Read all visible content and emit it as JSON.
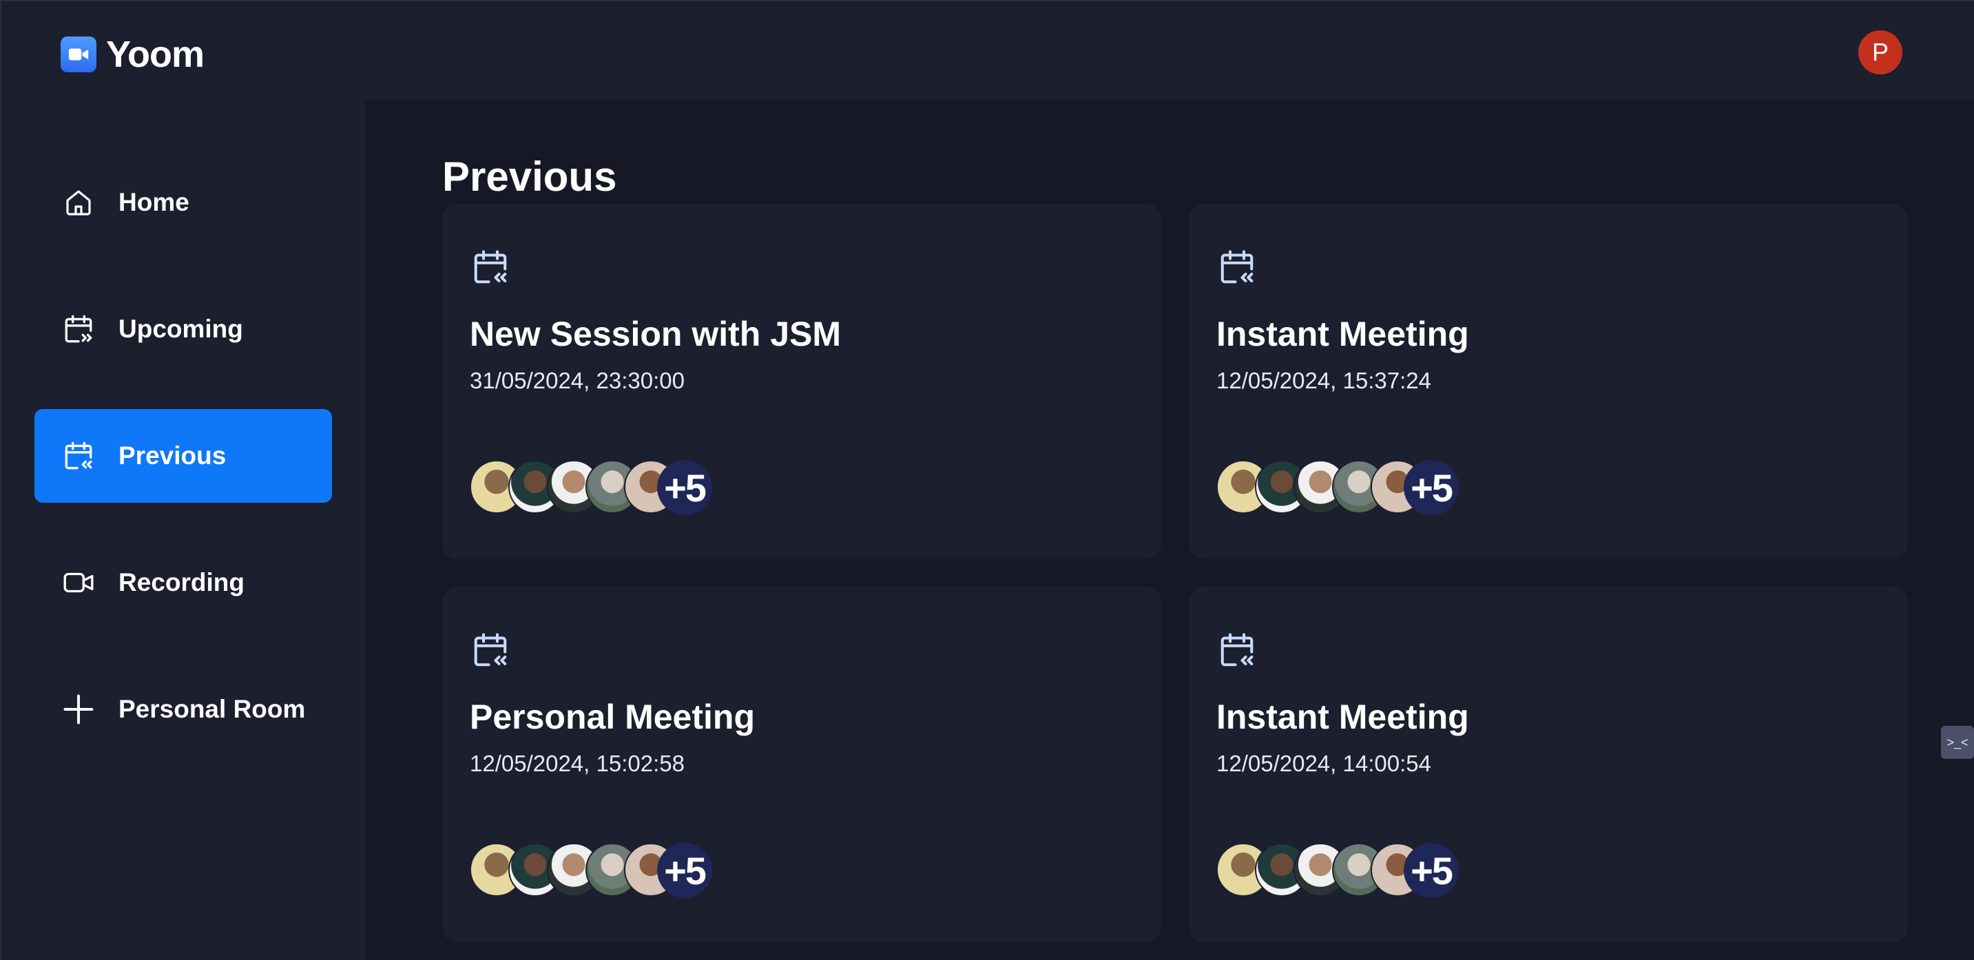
{
  "app": {
    "name": "Yoom",
    "user_initial": "P"
  },
  "sidebar": {
    "items": [
      {
        "label": "Home",
        "icon": "home-icon",
        "active": false
      },
      {
        "label": "Upcoming",
        "icon": "calendar-forward-icon",
        "active": false
      },
      {
        "label": "Previous",
        "icon": "calendar-back-icon",
        "active": true
      },
      {
        "label": "Recording",
        "icon": "video-icon",
        "active": false
      },
      {
        "label": "Personal Room",
        "icon": "plus-icon",
        "active": false
      }
    ]
  },
  "main": {
    "title": "Previous",
    "meetings": [
      {
        "title": "New Session with JSM",
        "date": "31/05/2024, 23:30:00",
        "extra_attendees": "+5"
      },
      {
        "title": "Instant Meeting",
        "date": "12/05/2024, 15:37:24",
        "extra_attendees": "+5"
      },
      {
        "title": "Personal Meeting",
        "date": "12/05/2024, 15:02:58",
        "extra_attendees": "+5"
      },
      {
        "title": "Instant Meeting",
        "date": "12/05/2024, 14:00:54",
        "extra_attendees": "+5"
      }
    ]
  },
  "colors": {
    "active_nav": "#0e78f9",
    "card_bg": "#1c1f2e",
    "page_bg": "#161925",
    "avatar_bg": "#c5301d"
  }
}
